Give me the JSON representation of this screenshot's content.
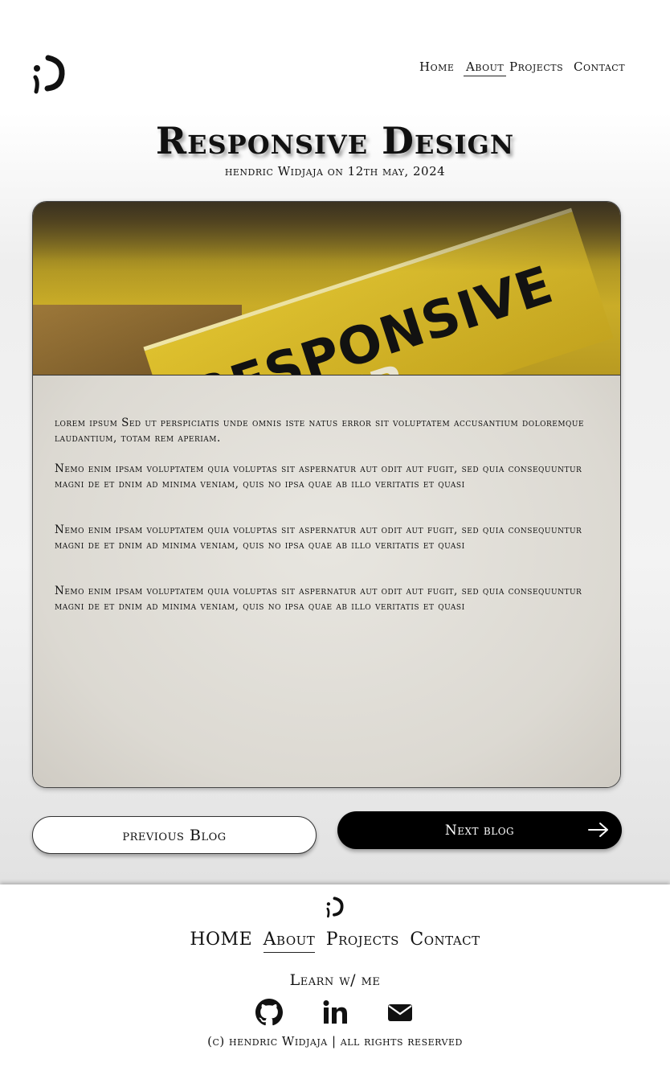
{
  "header": {
    "logo_icon": "wink-face-logo-icon",
    "nav": [
      {
        "label": "Home"
      },
      {
        "label": "About",
        "active": true
      },
      {
        "label": "Projects"
      },
      {
        "label": "Contact"
      }
    ]
  },
  "post": {
    "title": "Responsive Design",
    "byline": "hendric Widjaja on 12th may, 2024",
    "hero_icon": "responsive-web-design-book-image",
    "paragraphs": [
      "lorem ipsum Sed ut perspiciatis unde omnis iste natus error sit voluptatem accusantium doloremque laudantium, totam rem aperiam.",
      " Nemo enim ipsam voluptatem quia voluptas sit aspernatur aut odit aut fugit, sed quia consequuntur magni de et dnim ad minima veniam, quis no ipsa quae ab illo  veritatis et quasi",
      " Nemo enim ipsam voluptatem quia voluptas sit aspernatur aut odit aut fugit, sed quia consequuntur magni de et dnim ad minima veniam, quis no ipsa quae ab illo  veritatis et quasi",
      " Nemo enim ipsam voluptatem quia voluptas sit aspernatur aut odit aut fugit, sed quia consequuntur magni de et dnim ad minima veniam, quis no ipsa quae ab illo  veritatis et quasi"
    ]
  },
  "pagination": {
    "previous_label": "previous Blog",
    "next_label": "Next blog",
    "next_icon": "arrow-right-icon"
  },
  "footer": {
    "nav": [
      {
        "label": "HOME"
      },
      {
        "label": "About",
        "active": true
      },
      {
        "label": "Projects"
      },
      {
        "label": "Contact"
      }
    ],
    "learn_label": "Learn w/ me",
    "social_icons": [
      "github-icon",
      "linkedin-icon",
      "envelope-icon"
    ],
    "copyright": "(c) hendric Widjaja | all rights reserved"
  },
  "colors": {
    "accent": "#000000",
    "page_bg": "#f0f0f0",
    "card_bg": "#dedbd4"
  }
}
